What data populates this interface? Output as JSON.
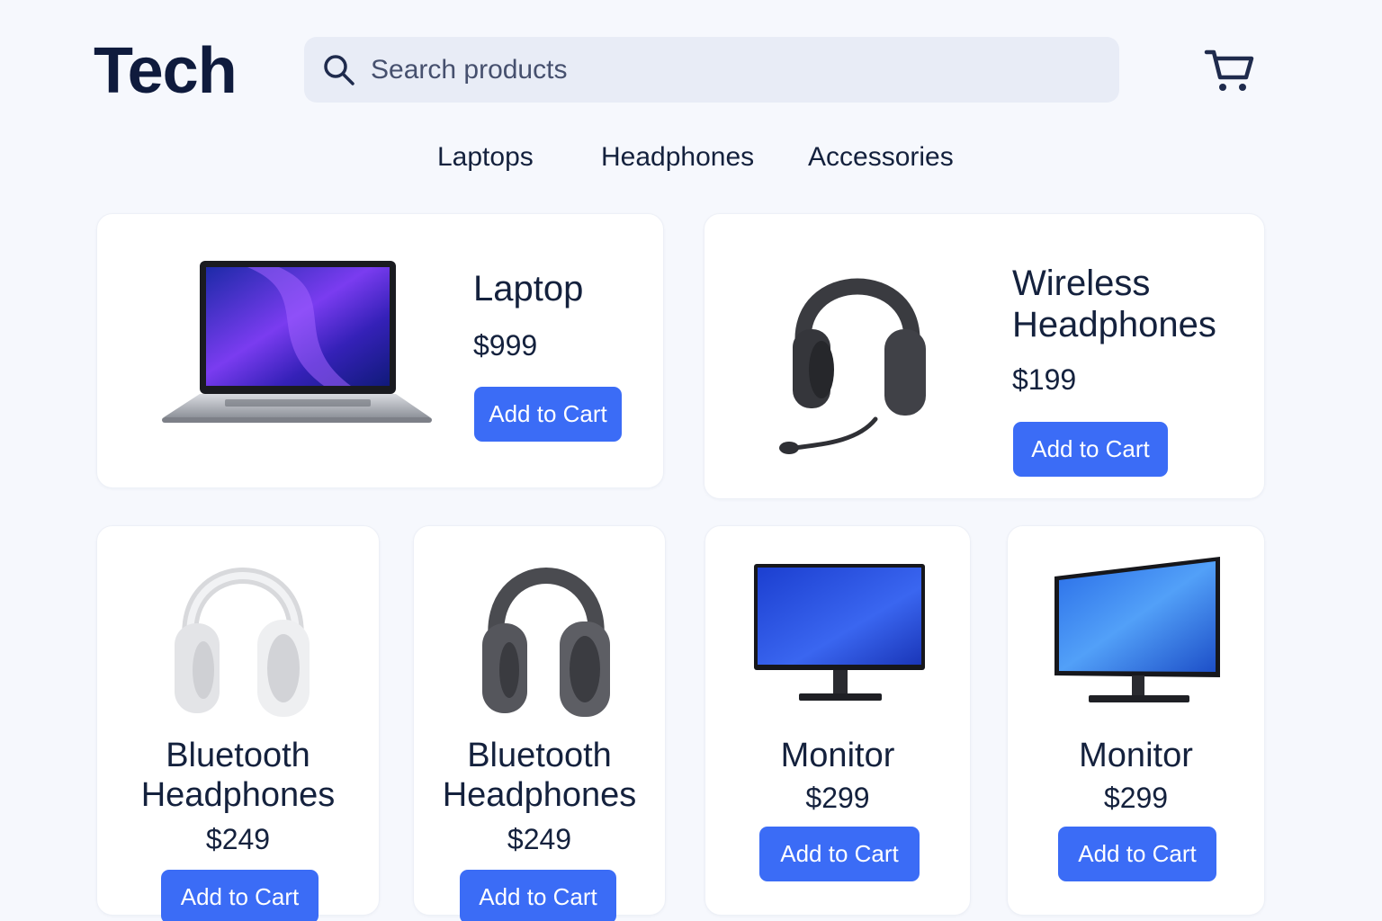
{
  "header": {
    "logo": "Tech",
    "search_placeholder": "Search products",
    "search_icon": "search-icon",
    "cart_icon": "cart-icon"
  },
  "nav": {
    "items": [
      "Laptops",
      "Headphones",
      "Accessories"
    ]
  },
  "products": [
    {
      "name": "Laptop",
      "price": "$999",
      "button": "Add to Cart",
      "image": "laptop-image"
    },
    {
      "name": "Wireless Headphones",
      "price": "$199",
      "button": "Add to Cart",
      "image": "headset-image"
    },
    {
      "name": "Bluetooth Headphones",
      "price": "$249",
      "button": "Add to Cart",
      "image": "white-headphones-image"
    },
    {
      "name": "Bluetooth Headphones",
      "price": "$249",
      "button": "Add to Cart",
      "image": "dark-headphones-image"
    },
    {
      "name": "Monitor",
      "price": "$299",
      "button": "Add to Cart",
      "image": "monitor-image"
    },
    {
      "name": "Monitor",
      "price": "$299",
      "button": "Add to Cart",
      "image": "monitor-image"
    }
  ],
  "colors": {
    "accent": "#3b6cf6",
    "text": "#14213d",
    "background": "#f6f8fd",
    "search_bg": "#e8ecf6"
  }
}
